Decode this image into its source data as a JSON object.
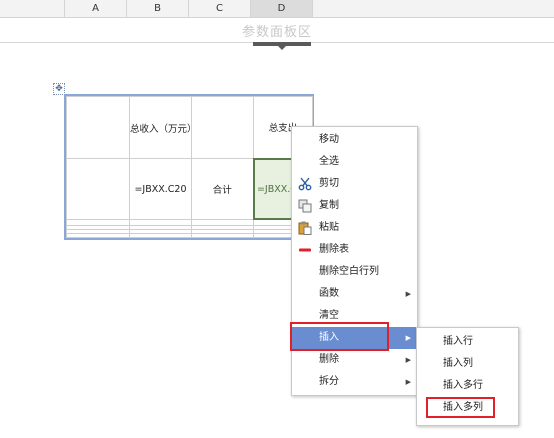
{
  "columns": [
    "A",
    "B",
    "C",
    "D"
  ],
  "param_panel": {
    "title": "参数面板区"
  },
  "table": {
    "rows": [
      [
        "",
        "总收入（万元）",
        "",
        "总支出"
      ],
      [
        "",
        "=JBXX.C20",
        "合计",
        "=JBXX.C20"
      ],
      [
        "",
        "",
        "",
        ""
      ],
      [
        "",
        "",
        "",
        ""
      ],
      [
        "",
        "",
        "",
        ""
      ],
      [
        "",
        "",
        "",
        ""
      ]
    ]
  },
  "context_menu": {
    "items": [
      {
        "label": "移动",
        "icon": ""
      },
      {
        "label": "全选",
        "icon": ""
      },
      {
        "label": "剪切",
        "icon": "scissors-icon"
      },
      {
        "label": "复制",
        "icon": "copy-icon"
      },
      {
        "label": "粘贴",
        "icon": "paste-icon"
      },
      {
        "label": "删除表",
        "icon": "delete-table-icon"
      },
      {
        "label": "删除空白行列",
        "icon": ""
      },
      {
        "label": "函数",
        "icon": "",
        "submenu": true
      },
      {
        "label": "清空",
        "icon": ""
      },
      {
        "label": "插入",
        "icon": "",
        "submenu": true,
        "highlighted": true
      },
      {
        "label": "删除",
        "icon": "",
        "submenu": true
      },
      {
        "label": "拆分",
        "icon": "",
        "submenu": true
      }
    ],
    "submenu_arrow": "▶"
  },
  "insert_submenu": {
    "items": [
      "插入行",
      "插入列",
      "插入多行",
      "插入多列"
    ]
  },
  "colors": {
    "highlight": "#6a8dd2",
    "annotation_red": "#e0202a",
    "selected_cell_border": "#5b7a4a"
  }
}
